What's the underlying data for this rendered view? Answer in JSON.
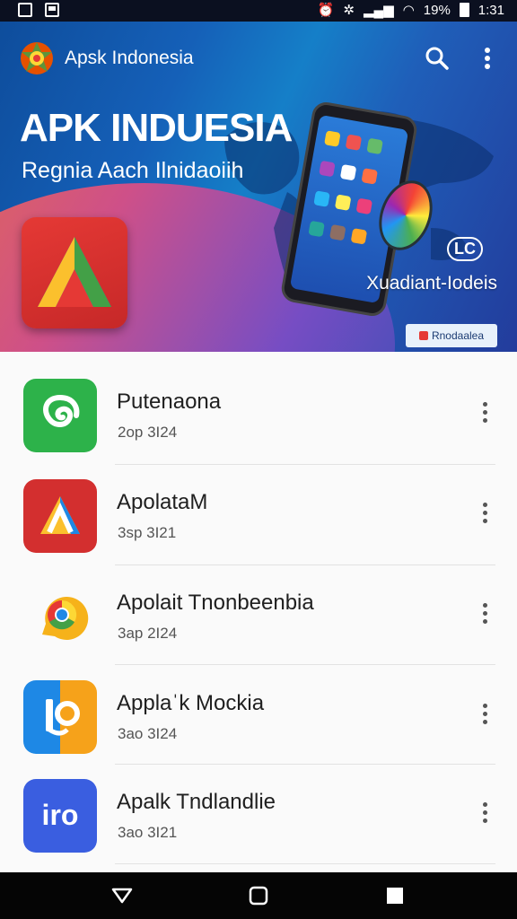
{
  "status_bar": {
    "battery_text": "19%",
    "time": "1:31"
  },
  "header": {
    "app_title": "Apsk Indonesia",
    "actions": [
      {
        "icon": "search-icon"
      },
      {
        "icon": "more-vert-icon"
      }
    ]
  },
  "banner": {
    "title": "APK INDUESIA",
    "subtitle": "Regnia Aach Ilnidaoiih",
    "promo_text": "Xuadiant-Iodeis",
    "promo_logo": "LC",
    "promo_button_label": "Rnodaalea"
  },
  "apps": [
    {
      "name": "Putenaona",
      "date": "2op 3I24",
      "icon": "green-swirl-icon",
      "color": "#2db24a"
    },
    {
      "name": "ApolataM",
      "date": "3sp 3I21",
      "icon": "red-a-icon",
      "color": "#d32f2f"
    },
    {
      "name": "Apolait Tnonbeenbia",
      "date": "3ap 2I24",
      "icon": "chrome-chat-icon",
      "color": "#f6b21a"
    },
    {
      "name": "Applaˈk Mockia",
      "date": "3ao 3I24",
      "icon": "io-icon",
      "color": "#1e88e5"
    },
    {
      "name": "Apalk Tndlandlie",
      "date": "3ao 3I21",
      "icon": "iro-icon",
      "color": "#3a5ee0"
    }
  ],
  "nav": [
    {
      "icon": "back-icon"
    },
    {
      "icon": "home-icon"
    },
    {
      "icon": "recents-icon"
    }
  ]
}
